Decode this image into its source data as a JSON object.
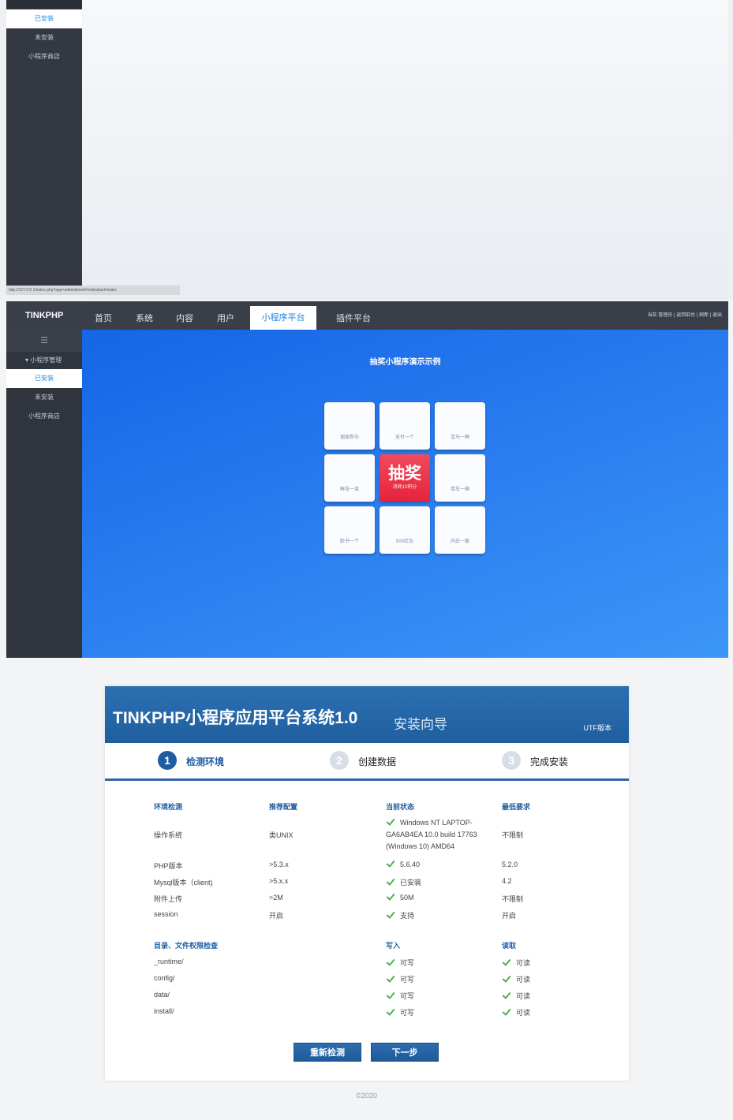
{
  "shot1": {
    "sidebar_items": [
      "已安装",
      "未安装",
      "小程序商店"
    ],
    "status_url": "http://127.0.0.1/index.php?app=admin&mod=index&act=index"
  },
  "admin": {
    "brand": "TINKPHP",
    "nav": [
      "首页",
      "系统",
      "内容",
      "用户",
      "小程序平台",
      "插件平台"
    ],
    "nav_active_index": 4,
    "nav_right": "当前 管理员 | 返回前台 | 刷新 | 退出",
    "menu_toggle": "☰",
    "sidebar_group": "▾ 小程序管理",
    "sidebar_items": [
      "已安装",
      "未安装",
      "小程序商店"
    ]
  },
  "lottery": {
    "title": "抽奖小程序演示示例",
    "prizes": [
      "谢谢参与",
      "支付一个",
      "宝马一辆",
      "鲜花一束",
      "单车一辆",
      "脸书一个",
      "500红包",
      "内衣一套"
    ],
    "center_label": "抽奖",
    "center_sub": "消耗10积分"
  },
  "installer": {
    "title": "TINKPHP小程序应用平台系统1.0",
    "subtitle": "安装向导",
    "encoding": "UTF版本",
    "steps": [
      {
        "num": "1",
        "label": "检测环境"
      },
      {
        "num": "2",
        "label": "创建数据"
      },
      {
        "num": "3",
        "label": "完成安装"
      }
    ],
    "active_step": 1,
    "env_headers": [
      "环境检测",
      "推荐配置",
      "当前状态",
      "最低要求"
    ],
    "env_rows": [
      {
        "name": "操作系统",
        "recommended": "类UNIX",
        "current": "Windows NT LAPTOP-GA6AB4EA 10.0 build 17763 (Windows 10) AMD64",
        "minimum": "不限制"
      },
      {
        "name": "PHP版本",
        "recommended": ">5.3.x",
        "current": "5.6.40",
        "minimum": "5.2.0"
      },
      {
        "name": "Mysql版本（client)",
        "recommended": ">5.x.x",
        "current": "已安装",
        "minimum": "4.2"
      },
      {
        "name": "附件上传",
        "recommended": ">2M",
        "current": "50M",
        "minimum": "不限制"
      },
      {
        "name": "session",
        "recommended": "开启",
        "current": "支持",
        "minimum": "开启"
      }
    ],
    "perm_headers": [
      "目录、文件权限检查",
      "写入",
      "读取"
    ],
    "perm_rows": [
      {
        "path": "_runtime/",
        "write": "可写",
        "read": "可读"
      },
      {
        "path": "config/",
        "write": "可写",
        "read": "可读"
      },
      {
        "path": "data/",
        "write": "可写",
        "read": "可读"
      },
      {
        "path": "install/",
        "write": "可写",
        "read": "可读"
      }
    ],
    "buttons": {
      "recheck": "重新检测",
      "next": "下一步"
    }
  },
  "copyright": "©2020",
  "colors": {
    "sidebar": "#333842",
    "active_blue": "#1e88e5",
    "header_blue": "#1f5f9f",
    "check_green": "#4caf50",
    "lottery_red": "#e5233c"
  }
}
